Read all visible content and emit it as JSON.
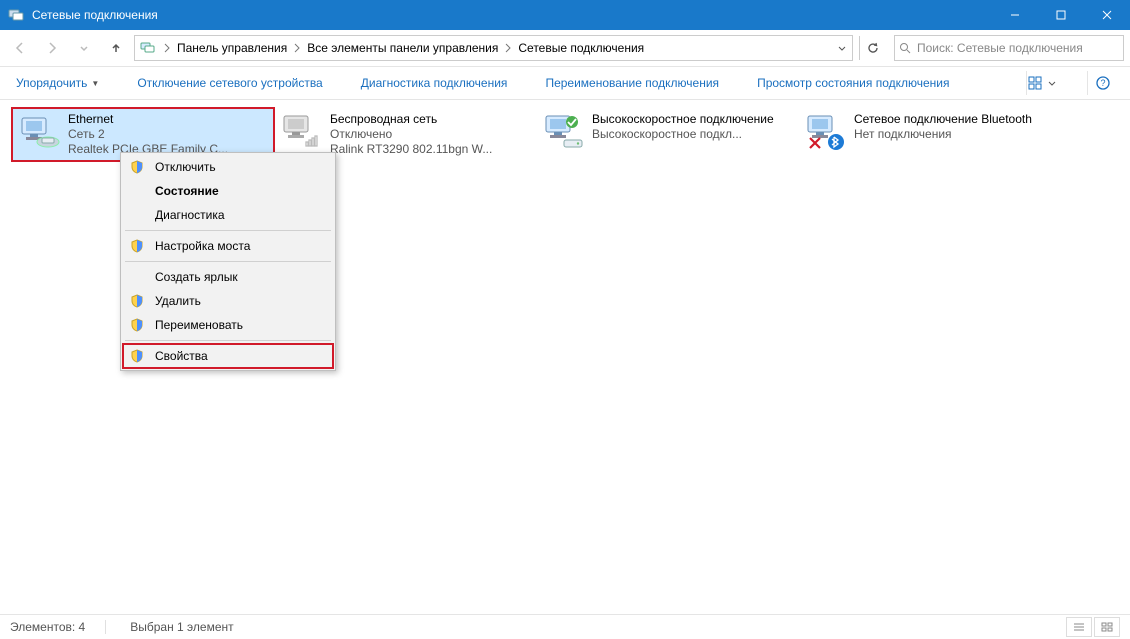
{
  "title": "Сетевые подключения",
  "breadcrumbs": [
    "Панель управления",
    "Все элементы панели управления",
    "Сетевые подключения"
  ],
  "search": {
    "placeholder": "Поиск: Сетевые подключения"
  },
  "toolbar": {
    "organize": "Упорядочить",
    "disable": "Отключение сетевого устройства",
    "diagnose": "Диагностика подключения",
    "rename": "Переименование подключения",
    "status": "Просмотр состояния подключения"
  },
  "connections": [
    {
      "name": "Ethernet",
      "status": "Сеть  2",
      "device": "Realtek PCIe GBE Family C..."
    },
    {
      "name": "Беспроводная сеть",
      "status": "Отключено",
      "device": "Ralink RT3290 802.11bgn W..."
    },
    {
      "name": "Высокоскоростное подключение",
      "status": "",
      "device": "Высокоскоростное подкл..."
    },
    {
      "name": "Сетевое подключение Bluetooth",
      "status": "",
      "device": "Нет подключения"
    }
  ],
  "context_menu": {
    "items": [
      {
        "label": "Отключить",
        "shield": true
      },
      {
        "label": "Состояние",
        "bold": true
      },
      {
        "label": "Диагностика"
      },
      {
        "sep": true
      },
      {
        "label": "Настройка моста",
        "shield": true
      },
      {
        "sep": true
      },
      {
        "label": "Создать ярлык"
      },
      {
        "label": "Удалить",
        "shield": true
      },
      {
        "label": "Переименовать",
        "shield": true
      },
      {
        "sep": true
      },
      {
        "label": "Свойства",
        "shield": true,
        "highlight": true
      }
    ]
  },
  "statusbar": {
    "count": "Элементов: 4",
    "selected": "Выбран 1 элемент"
  }
}
